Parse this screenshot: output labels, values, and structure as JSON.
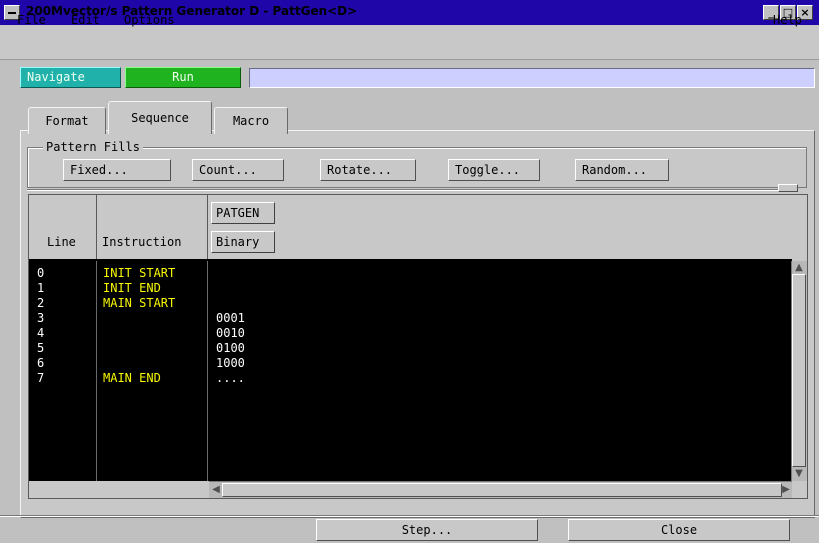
{
  "window": {
    "title": "200Mvector/s Pattern Generator D - PattGen<D>",
    "controls": {
      "minimize": "_",
      "maximize": "□",
      "close": "×"
    }
  },
  "menubar": {
    "file": "File",
    "edit": "Edit",
    "options": "Options",
    "help": "Help"
  },
  "toolbar": {
    "navigate": "Navigate",
    "run": "Run",
    "status_text": ""
  },
  "tabs": [
    {
      "label": "Format",
      "active": false
    },
    {
      "label": "Sequence",
      "active": true
    },
    {
      "label": "Macro",
      "active": false
    }
  ],
  "pattern_fills": {
    "label": "Pattern Fills",
    "buttons": [
      "Fixed...",
      "Count...",
      "Rotate...",
      "Toggle...",
      "Random..."
    ]
  },
  "table": {
    "col_line": "Line",
    "col_instruction": "Instruction",
    "col_label": "PATGEN",
    "col_format": "Binary",
    "rows": [
      {
        "line": "0",
        "instruction": "INIT START",
        "pattern": ""
      },
      {
        "line": "1",
        "instruction": "INIT END",
        "pattern": ""
      },
      {
        "line": "2",
        "instruction": "MAIN START",
        "pattern": ""
      },
      {
        "line": "3",
        "instruction": "",
        "pattern": "0001"
      },
      {
        "line": "4",
        "instruction": "",
        "pattern": "0010"
      },
      {
        "line": "5",
        "instruction": "",
        "pattern": "0100"
      },
      {
        "line": "6",
        "instruction": "",
        "pattern": "1000"
      },
      {
        "line": "7",
        "instruction": "MAIN END",
        "pattern": "...."
      }
    ]
  },
  "bottom": {
    "step": "Step...",
    "close": "Close"
  },
  "colors": {
    "titlebar": "#1e06a8",
    "navigate": "#20b2aa",
    "run": "#1fb31f",
    "data_bg": "#000000",
    "instruction_text": "#f8f800",
    "status_field": "#cdd0ff"
  }
}
